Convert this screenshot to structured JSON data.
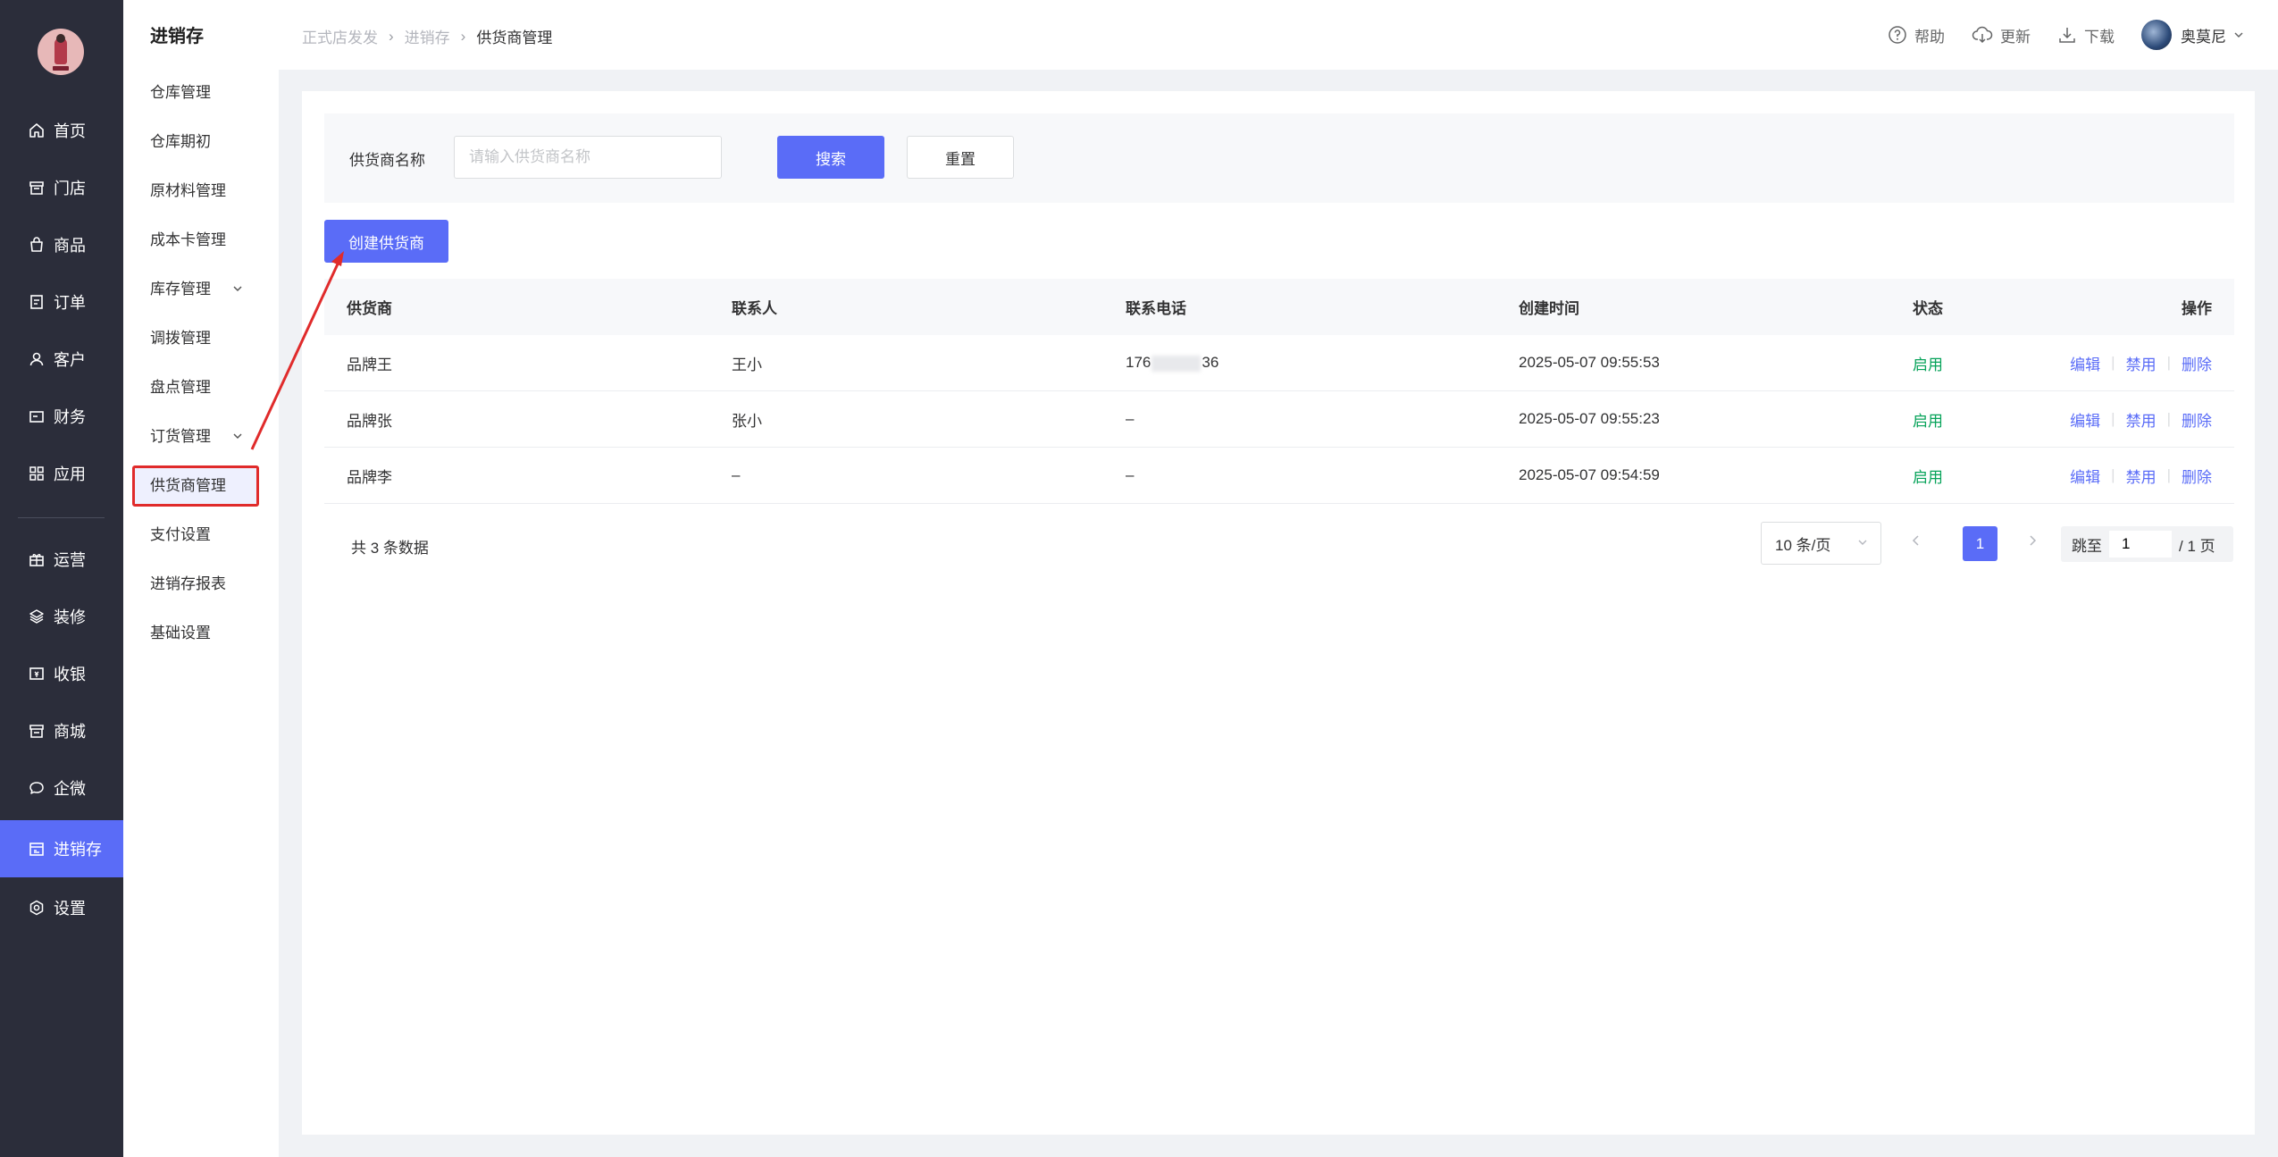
{
  "nav": {
    "items": [
      {
        "label": "首页",
        "icon": "home-icon"
      },
      {
        "label": "门店",
        "icon": "store-icon"
      },
      {
        "label": "商品",
        "icon": "bag-icon"
      },
      {
        "label": "订单",
        "icon": "order-icon"
      },
      {
        "label": "客户",
        "icon": "user-icon"
      },
      {
        "label": "财务",
        "icon": "wallet-icon"
      },
      {
        "label": "应用",
        "icon": "apps-icon"
      },
      {
        "label": "运营",
        "icon": "gift-icon"
      },
      {
        "label": "装修",
        "icon": "layers-icon"
      },
      {
        "label": "收银",
        "icon": "cashier-icon"
      },
      {
        "label": "商城",
        "icon": "mall-icon"
      },
      {
        "label": "企微",
        "icon": "chat-icon"
      },
      {
        "label": "进销存",
        "icon": "inventory-icon"
      },
      {
        "label": "设置",
        "icon": "settings-icon"
      }
    ],
    "active_index": 12,
    "accent_color": "#5a6cf7"
  },
  "side": {
    "title": "进销存",
    "items": [
      {
        "label": "仓库管理"
      },
      {
        "label": "仓库期初"
      },
      {
        "label": "原材料管理"
      },
      {
        "label": "成本卡管理"
      },
      {
        "label": "库存管理",
        "expandable": true
      },
      {
        "label": "调拨管理"
      },
      {
        "label": "盘点管理"
      },
      {
        "label": "订货管理",
        "expandable": true
      },
      {
        "label": "供货商管理",
        "selected": true
      },
      {
        "label": "支付设置"
      },
      {
        "label": "进销存报表"
      },
      {
        "label": "基础设置"
      }
    ]
  },
  "header": {
    "breadcrumb": [
      "正式店发发",
      "进销存",
      "供货商管理"
    ],
    "actions": [
      {
        "label": "帮助",
        "icon": "help-icon"
      },
      {
        "label": "更新",
        "icon": "cloud-update-icon"
      },
      {
        "label": "下载",
        "icon": "download-icon"
      }
    ],
    "user": "奥莫尼"
  },
  "filter": {
    "label": "供货商名称",
    "placeholder": "请输入供货商名称",
    "value": "",
    "search_label": "搜索",
    "reset_label": "重置"
  },
  "create_label": "创建供货商",
  "table": {
    "columns": [
      "供货商",
      "联系人",
      "联系电话",
      "创建时间",
      "状态",
      "操作"
    ],
    "rows": [
      {
        "supplier": "品牌王",
        "contact": "王小",
        "phone_prefix": "176",
        "phone_suffix": "36",
        "phone_masked": true,
        "created": "2025-05-07 09:55:53",
        "status": "启用"
      },
      {
        "supplier": "品牌张",
        "contact": "张小",
        "phone": "–",
        "phone_masked": false,
        "created": "2025-05-07 09:55:23",
        "status": "启用"
      },
      {
        "supplier": "品牌李",
        "contact": "–",
        "phone": "–",
        "phone_masked": false,
        "created": "2025-05-07 09:54:59",
        "status": "启用"
      }
    ],
    "row_actions": [
      "编辑",
      "禁用",
      "删除"
    ]
  },
  "pagination": {
    "total_text": "共 3 条数据",
    "page_size": "10 条/页",
    "current_page": "1",
    "jump_label": "跳至",
    "jump_value": "1",
    "total_pages_text": "/ 1 页"
  }
}
